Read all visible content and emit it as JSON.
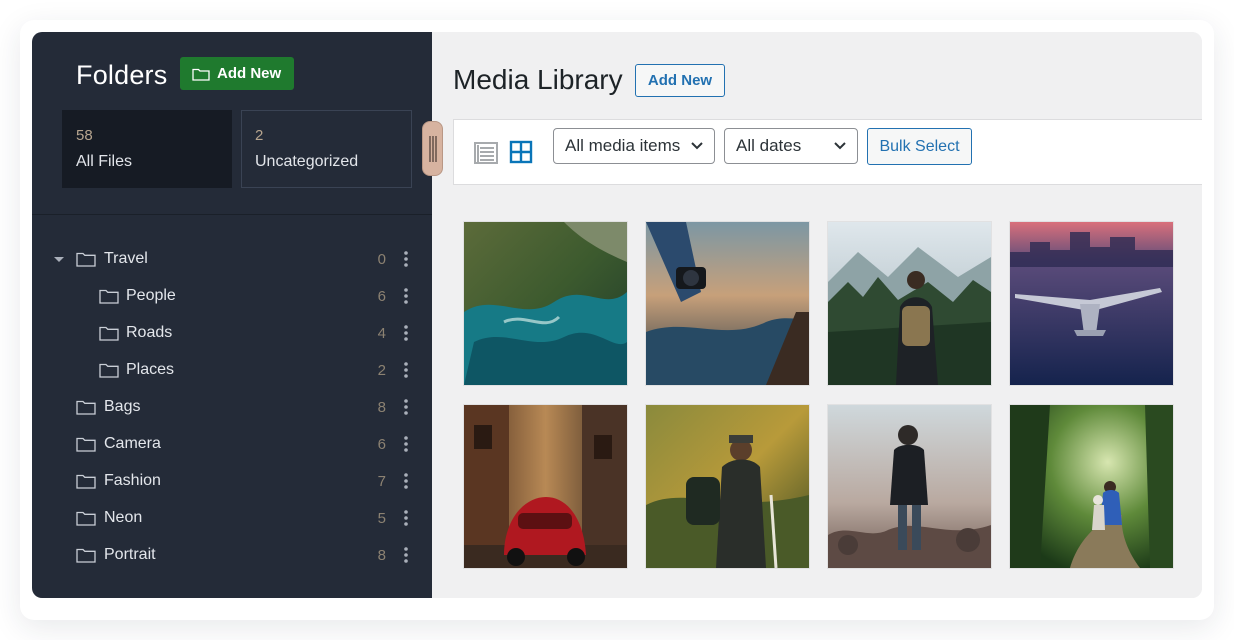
{
  "sidebar": {
    "title": "Folders",
    "add_new_label": "Add New",
    "stats": [
      {
        "count": "58",
        "label": "All Files"
      },
      {
        "count": "2",
        "label": "Uncategorized"
      }
    ],
    "tree": [
      {
        "name": "Travel",
        "count": "0"
      },
      {
        "name": "People",
        "count": "6"
      },
      {
        "name": "Roads",
        "count": "4"
      },
      {
        "name": "Places",
        "count": "2"
      },
      {
        "name": "Bags",
        "count": "8"
      },
      {
        "name": "Camera",
        "count": "6"
      },
      {
        "name": "Fashion",
        "count": "7"
      },
      {
        "name": "Neon",
        "count": "5"
      },
      {
        "name": "Portrait",
        "count": "8"
      }
    ]
  },
  "main": {
    "title": "Media Library",
    "add_new_label": "Add New",
    "filters": {
      "media_type": "All media items",
      "dates": "All dates"
    },
    "bulk_select_label": "Bulk Select",
    "view_modes": [
      "list-view-icon",
      "grid-view-icon"
    ],
    "active_view": "grid",
    "thumbnails": [
      "aerial-coastline-photo",
      "hand-holding-camera-photo",
      "hiker-forest-mountain-photo",
      "airplane-over-city-photo",
      "red-beetle-car-street-photo",
      "hiker-with-backpack-photo",
      "photographer-on-rocks-photo",
      "hikers-forest-trail-photo"
    ]
  },
  "colors": {
    "sidebar_bg": "#242b38",
    "add_folder_green": "#1f7a2e",
    "wp_blue": "#2271b1",
    "main_bg": "#f0f0f1"
  }
}
